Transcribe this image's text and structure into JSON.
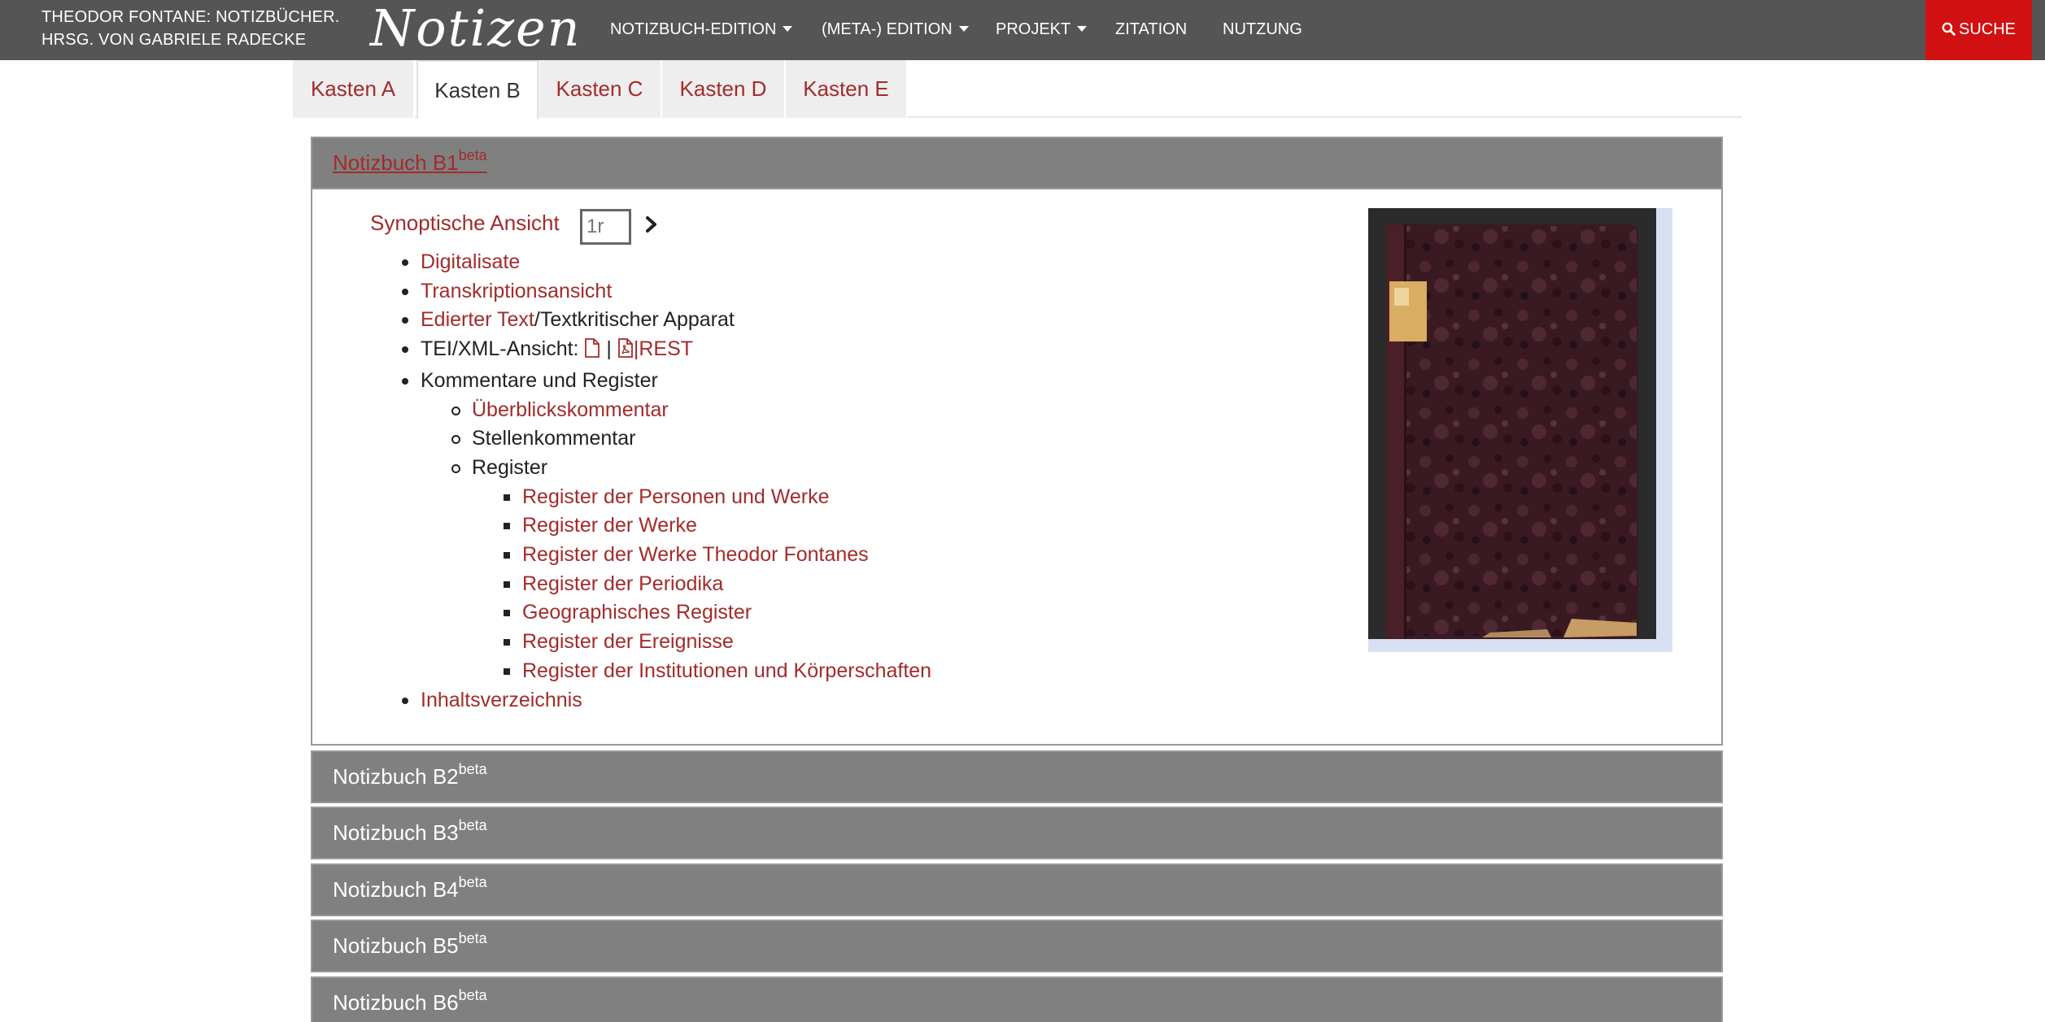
{
  "header": {
    "brand_line1": "THEODOR FONTANE: NOTIZBÜCHER.",
    "brand_line2": "HRSG. VON GABRIELE RADECKE",
    "logo_text": "Notizen",
    "nav": [
      {
        "label": "NOTIZBUCH-EDITION",
        "dropdown": true
      },
      {
        "label": "(META-) EDITION",
        "dropdown": true
      },
      {
        "label": "PROJEKT",
        "dropdown": true
      },
      {
        "label": "ZITATION",
        "dropdown": false
      },
      {
        "label": "NUTZUNG",
        "dropdown": false
      }
    ],
    "search_label": "SUCHE"
  },
  "tabs": [
    "Kasten A",
    "Kasten B",
    "Kasten C",
    "Kasten D",
    "Kasten E"
  ],
  "active_tab": "Kasten B",
  "notebook_open": {
    "title": "Notizbuch B1",
    "badge": "beta",
    "synoptic_label": "Synoptische Ansicht",
    "synoptic_placeholder": "1r",
    "links": {
      "digitalisate": "Digitalisate",
      "transkription": "Transkriptionsansicht",
      "edierter_text": "Edierter Text",
      "apparat": "/Textkritischer Apparat",
      "tei_label": "TEI/XML-Ansicht: ",
      "tei_sep": " | ",
      "tei_rest": "|REST",
      "kommentare": "Kommentare und Register",
      "ueberblick": "Überblickskommentar",
      "stellen": "Stellenkommentar",
      "register": "Register",
      "inhalt": "Inhaltsverzeichnis"
    },
    "registers": [
      "Register der Personen und Werke",
      "Register der Werke",
      "Register der Werke Theodor Fontanes",
      "Register der Periodika",
      "Geographisches Register",
      "Register der Ereignisse",
      "Register der Institutionen und Körperschaften"
    ]
  },
  "notebooks_closed": [
    {
      "title": "Notizbuch B2",
      "badge": "beta"
    },
    {
      "title": "Notizbuch B3",
      "badge": "beta"
    },
    {
      "title": "Notizbuch B4",
      "badge": "beta"
    },
    {
      "title": "Notizbuch B5",
      "badge": "beta"
    },
    {
      "title": "Notizbuch B6",
      "badge": "beta"
    }
  ],
  "colors": {
    "navbar": "#555555",
    "search": "#d11111",
    "link": "#a32b2b",
    "panel_head": "#808080"
  },
  "icons": [
    "search-icon",
    "caret-down-icon",
    "chevron-right-icon",
    "file-icon",
    "pdf-file-icon",
    "notebook-cover-image"
  ]
}
